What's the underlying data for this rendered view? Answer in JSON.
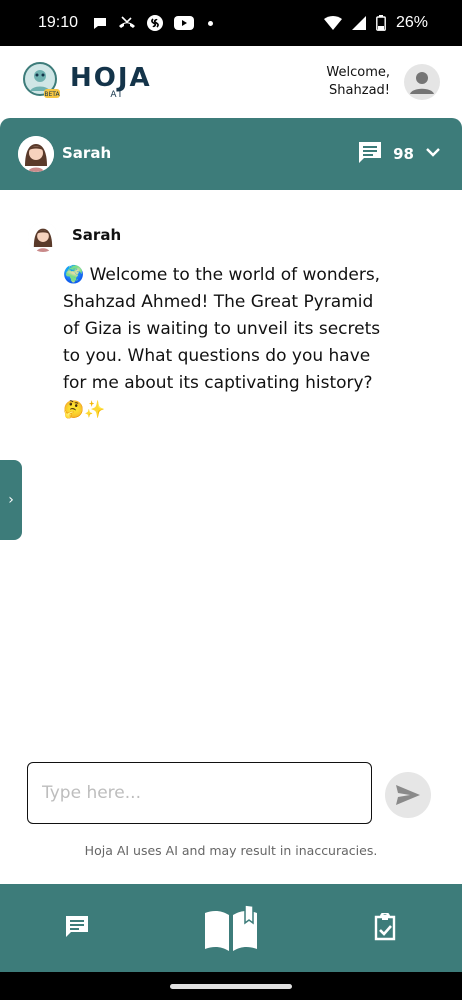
{
  "status_bar": {
    "time": "19:10",
    "battery": "26%",
    "icons_left": [
      "chat-bubble-icon",
      "missed-call-icon",
      "shazam-icon",
      "youtube-icon",
      "dot-icon"
    ],
    "icons_right": [
      "wifi-icon",
      "signal-icon",
      "battery-icon"
    ]
  },
  "header": {
    "brand_name": "HOJA",
    "brand_sub": "AI",
    "beta_badge": "BETA",
    "welcome_line1": "Welcome,",
    "welcome_line2": "Shahzad!"
  },
  "chat_header": {
    "character_name": "Sarah",
    "message_count": "98"
  },
  "message": {
    "sender": "Sarah",
    "text": "🌍 Welcome to the world of wonders, Shahzad Ahmed! The Great Pyramid of Giza is waiting to unveil its secrets to you. What questions do you have for me about its captivating history? 🤔✨"
  },
  "composer": {
    "placeholder": "Type here...",
    "value": ""
  },
  "disclaimer": "Hoja AI uses AI and may result in inaccuracies.",
  "side_tab_icon": "›",
  "colors": {
    "primary": "#3d7c7a",
    "brand_text": "#14344a",
    "send_bg": "#e6e6e6"
  }
}
